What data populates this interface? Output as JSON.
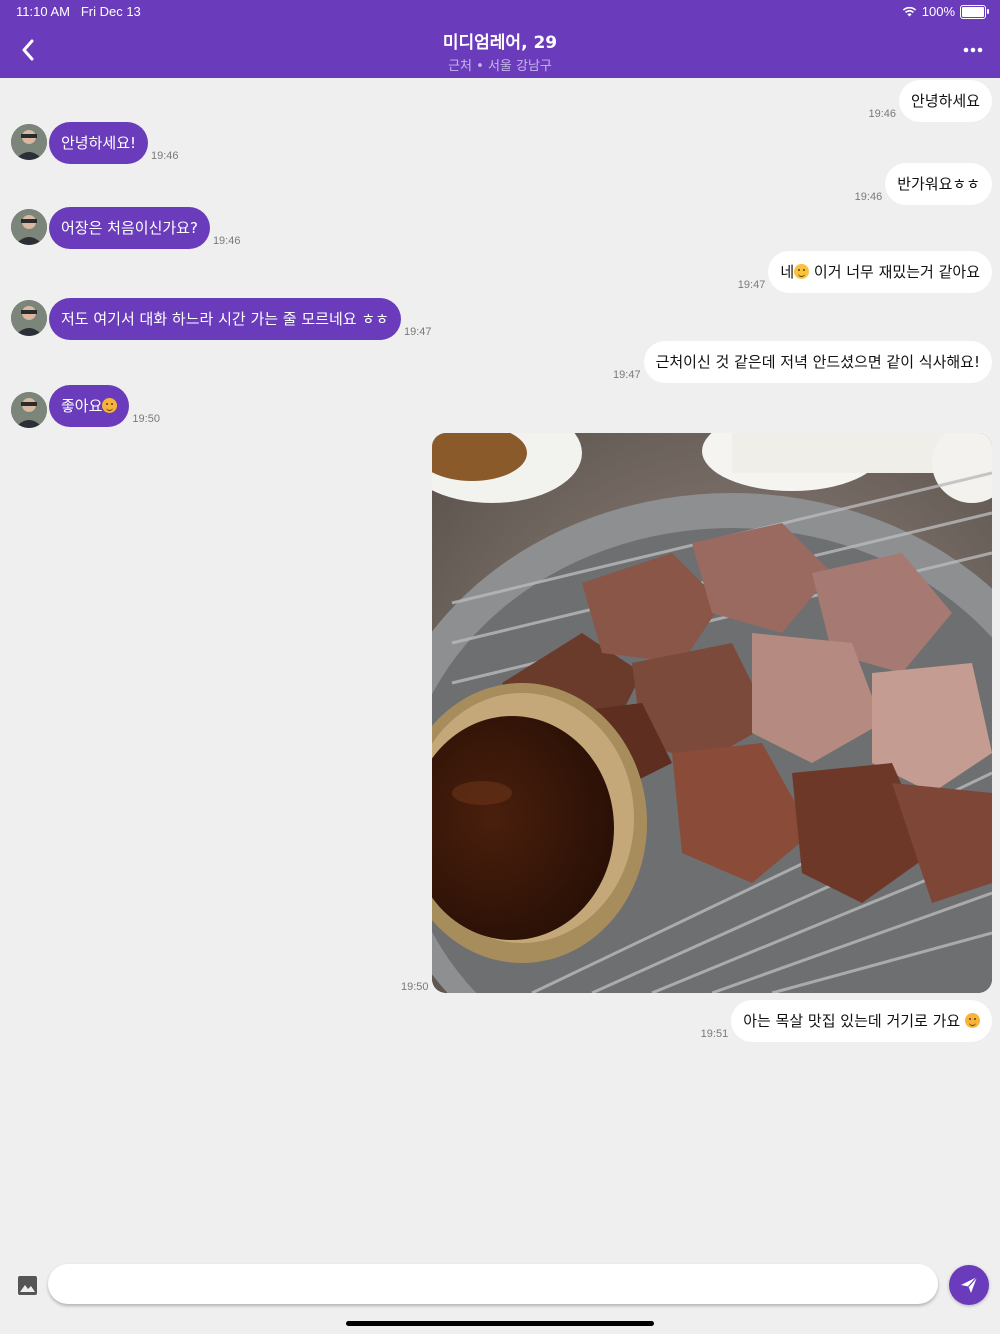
{
  "status_bar": {
    "time": "11:10 AM",
    "date": "Fri Dec 13",
    "battery": "100%"
  },
  "header": {
    "title": "미디엄레어, 29",
    "subtitle": "근처 • 서울 강남구"
  },
  "messages": [
    {
      "side": "out",
      "text": "안녕하세요",
      "time": "19:46"
    },
    {
      "side": "in",
      "text": "안녕하세요!",
      "time": "19:46"
    },
    {
      "side": "out",
      "text": "반가워요ㅎㅎ",
      "time": "19:46"
    },
    {
      "side": "in",
      "text": "어장은 처음이신가요?",
      "time": "19:46"
    },
    {
      "side": "out",
      "text_before": "네",
      "text": " 이거 너무 재밌는거 같아요",
      "time": "19:47"
    },
    {
      "side": "in",
      "text": "저도 여기서 대화 하느라 시간 가는 줄 모르네요 ㅎㅎ",
      "time": "19:47"
    },
    {
      "side": "out",
      "text": "근처이신 것 같은데 저녁 안드셨으면 같이 식사해요!",
      "time": "19:47"
    },
    {
      "side": "in",
      "text": "좋아요",
      "time": "19:50"
    },
    {
      "side": "out",
      "type": "image",
      "time": "19:50"
    },
    {
      "side": "out",
      "text": "아는 목살 맛집 있는데 거기로 가요 ",
      "time": "19:51"
    }
  ],
  "composer": {
    "placeholder": ""
  },
  "colors": {
    "accent": "#6a3cbc",
    "background": "#efefef"
  },
  "icons": [
    "back-arrow-icon",
    "more-icon",
    "wifi-icon",
    "battery-icon",
    "image-icon",
    "send-icon"
  ]
}
